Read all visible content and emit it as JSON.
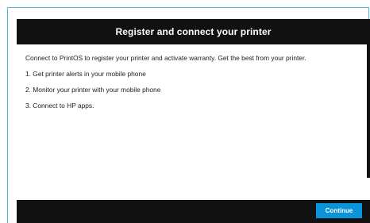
{
  "dialog": {
    "title": "Register and connect your printer",
    "intro": "Connect to PrintOS to register your printer and activate warranty. Get the best from your printer.",
    "items": [
      "1. Get printer alerts in your mobile phone",
      "2. Monitor your printer with your mobile phone",
      "3. Connect to HP apps."
    ],
    "continue_label": "Continue"
  },
  "colors": {
    "header_bg": "#111111",
    "accent": "#0a93d8",
    "frame_border": "#4fb6e6"
  }
}
